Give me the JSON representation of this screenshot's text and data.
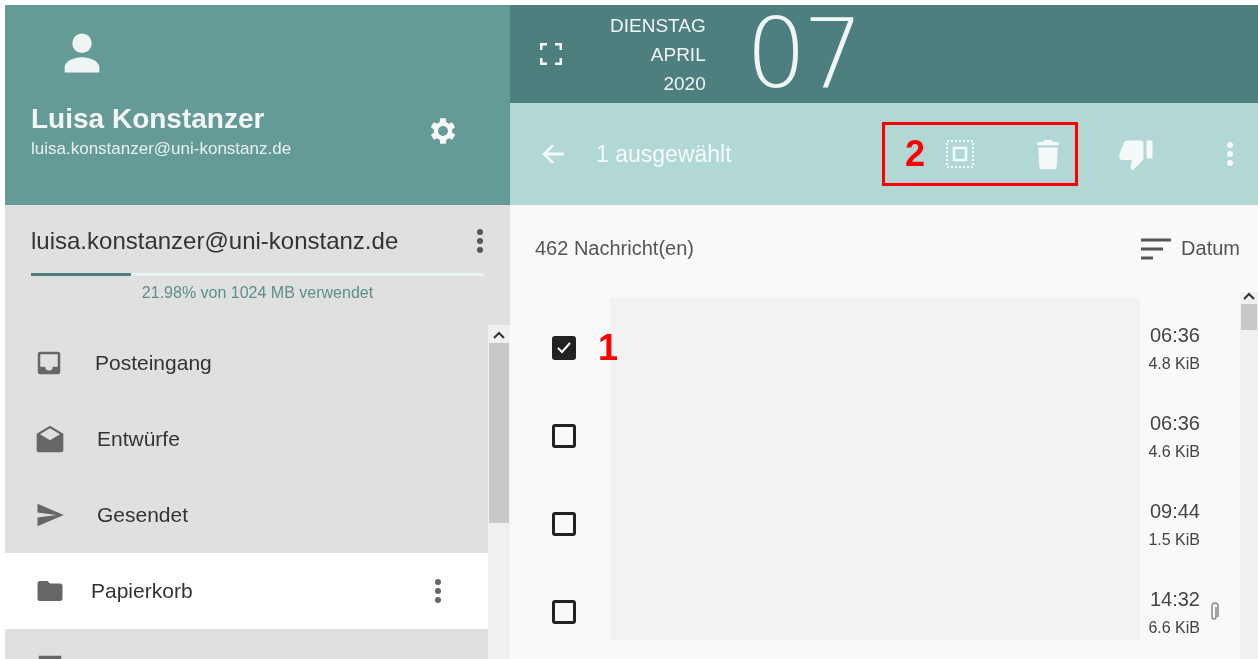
{
  "user": {
    "name": "Luisa Konstanzer",
    "email": "luisa.konstanzer@uni-konstanz.de"
  },
  "account": {
    "email": "luisa.konstanzer@uni-konstanz.de",
    "quota": {
      "level": 0.22,
      "label": "21.98% von 1024 MB verwendet"
    }
  },
  "folders": [
    {
      "kind": "inbox",
      "label": "Posteingang",
      "selected": false
    },
    {
      "kind": "draft",
      "label": "Entwürfe",
      "selected": false
    },
    {
      "kind": "sent",
      "label": "Gesendet",
      "selected": false
    },
    {
      "kind": "trash",
      "label": "Papierkorb",
      "selected": true
    },
    {
      "kind": "archive",
      "selected": false
    }
  ],
  "calendar": {
    "weekday": "DIENSTAG",
    "month": "APRIL",
    "year": "2020",
    "day": "07"
  },
  "selection_bar": {
    "label": "1 ausgewählt",
    "annotation": "2"
  },
  "messages": {
    "count": "462 Nachricht(en)",
    "sort": "Datum",
    "rows": [
      {
        "checked": true,
        "time": "06:36",
        "size": "4.8 KiB",
        "attachment": false,
        "annotation": "1"
      },
      {
        "checked": false,
        "time": "06:36",
        "size": "4.6 KiB",
        "attachment": false
      },
      {
        "checked": false,
        "time": "09:44",
        "size": "1.5 KiB",
        "attachment": false
      },
      {
        "checked": false,
        "time": "14:32",
        "size": "6.6 KiB",
        "attachment": true
      }
    ]
  }
}
